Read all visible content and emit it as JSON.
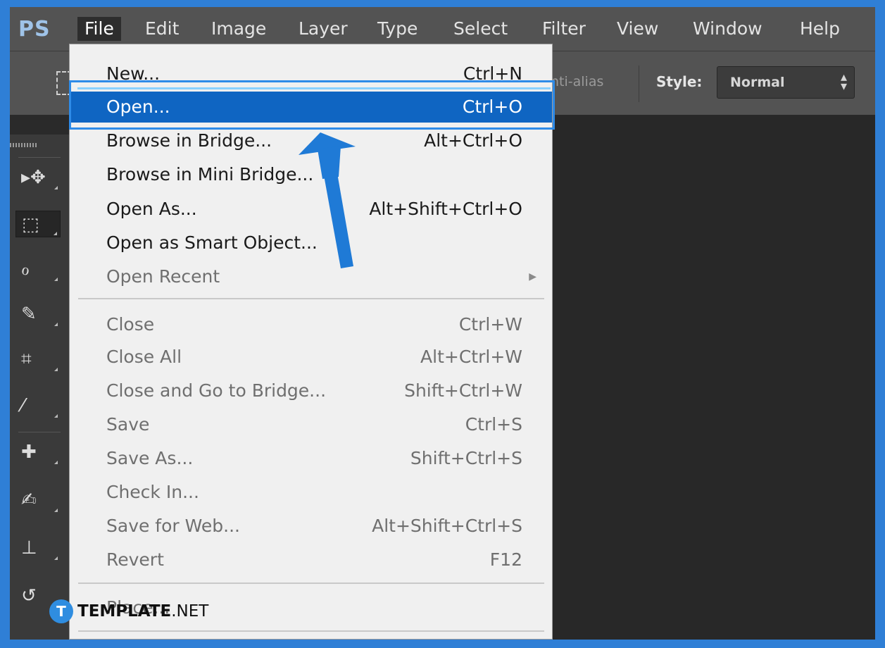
{
  "menubar": {
    "logo": "PS",
    "items": [
      "File",
      "Edit",
      "Image",
      "Layer",
      "Type",
      "Select",
      "Filter",
      "View",
      "Window",
      "Help"
    ],
    "active": "File"
  },
  "options_bar": {
    "antialias_label": "nti-alias",
    "style_label": "Style:",
    "style_value": "Normal"
  },
  "file_menu": {
    "items": [
      {
        "label": "New...",
        "shortcut": "Ctrl+N",
        "enabled": true
      },
      {
        "label": "Open...",
        "shortcut": "Ctrl+O",
        "enabled": true,
        "highlighted": true
      },
      {
        "label": "Browse in Bridge...",
        "shortcut": "Alt+Ctrl+O",
        "enabled": true
      },
      {
        "label": "Browse in Mini Bridge...",
        "shortcut": "",
        "enabled": true
      },
      {
        "label": "Open As...",
        "shortcut": "Alt+Shift+Ctrl+O",
        "enabled": true
      },
      {
        "label": "Open as Smart Object...",
        "shortcut": "",
        "enabled": true
      },
      {
        "label": "Open Recent",
        "shortcut": "",
        "enabled": false,
        "submenu": true
      },
      {
        "label": "Close",
        "shortcut": "Ctrl+W",
        "enabled": false
      },
      {
        "label": "Close All",
        "shortcut": "Alt+Ctrl+W",
        "enabled": false
      },
      {
        "label": "Close and Go to Bridge...",
        "shortcut": "Shift+Ctrl+W",
        "enabled": false
      },
      {
        "label": "Save",
        "shortcut": "Ctrl+S",
        "enabled": false
      },
      {
        "label": "Save As...",
        "shortcut": "Shift+Ctrl+S",
        "enabled": false
      },
      {
        "label": "Check In...",
        "shortcut": "",
        "enabled": false
      },
      {
        "label": "Save for Web...",
        "shortcut": "Alt+Shift+Ctrl+S",
        "enabled": false
      },
      {
        "label": "Revert",
        "shortcut": "F12",
        "enabled": false
      },
      {
        "label": "Place...",
        "shortcut": "",
        "enabled": false
      }
    ]
  },
  "tools": [
    {
      "icon": "move-tool-icon",
      "glyph": "▸✥"
    },
    {
      "icon": "rectangular-marquee-tool-icon",
      "glyph": "⬚",
      "selected": true
    },
    {
      "icon": "lasso-tool-icon",
      "glyph": "ℴ"
    },
    {
      "icon": "quick-selection-tool-icon",
      "glyph": "✎"
    },
    {
      "icon": "crop-tool-icon",
      "glyph": "⌗"
    },
    {
      "icon": "eyedropper-tool-icon",
      "glyph": "⁄"
    },
    {
      "icon": "spot-healing-brush-tool-icon",
      "glyph": "✚"
    },
    {
      "icon": "brush-tool-icon",
      "glyph": "✍"
    },
    {
      "icon": "clone-stamp-tool-icon",
      "glyph": "⊥"
    },
    {
      "icon": "history-brush-tool-icon",
      "glyph": "↺"
    }
  ],
  "watermark": {
    "badge": "T",
    "brand_bold": "TEMPLATE",
    "brand_suffix": ".NET"
  },
  "colors": {
    "frame": "#2f7fd6",
    "menubar": "#535353",
    "canvas": "#282828",
    "menu_bg": "#f0f0f0",
    "menu_highlight": "#0f65c2",
    "annotation_arrow": "#1f7ad6"
  }
}
